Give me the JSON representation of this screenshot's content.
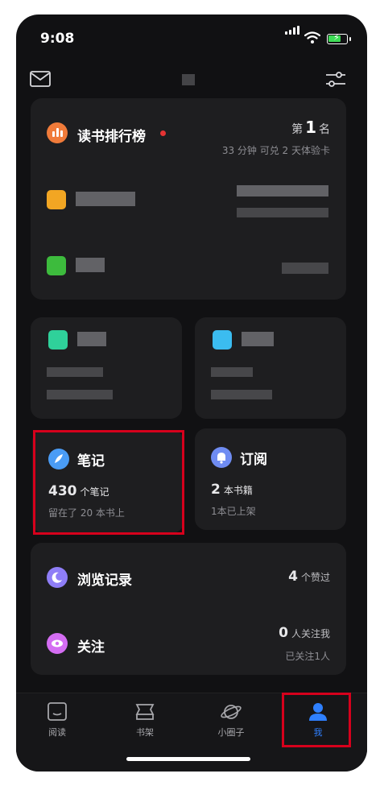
{
  "status_bar": {
    "time": "9:08"
  },
  "ranking": {
    "title": "读书排行榜",
    "position_prefix": "第",
    "position": "1",
    "position_suffix": "名",
    "subtitle": "33 分钟 可兑 2 天体验卡"
  },
  "notes": {
    "title": "笔记",
    "count": "430",
    "count_unit": "个笔记",
    "detail": "留在了 20 本书上"
  },
  "subscriptions": {
    "title": "订阅",
    "count": "2",
    "count_unit": "本书籍",
    "detail": "1本已上架"
  },
  "browse": {
    "title": "浏览记录",
    "likes_count": "4",
    "likes_unit": "个赞过"
  },
  "follow": {
    "title": "关注",
    "followers_count": "0",
    "followers_unit": "人关注我",
    "following_detail": "已关注1人"
  },
  "nav": [
    {
      "label": "阅读",
      "icon": "book-icon"
    },
    {
      "label": "书架",
      "icon": "bookshelf-icon"
    },
    {
      "label": "小圈子",
      "icon": "planet-icon"
    },
    {
      "label": "我",
      "icon": "person-icon",
      "active": true
    }
  ],
  "colors": {
    "accent": "#2f80ff",
    "highlight_box": "#d6001c",
    "rank_icon": "#f07b3a",
    "notes_icon": "#4a9cf5",
    "subscriptions_icon": "#6f8cf2",
    "browse_icon": "#8f7ef7",
    "follow_icon": "#d46df2"
  }
}
